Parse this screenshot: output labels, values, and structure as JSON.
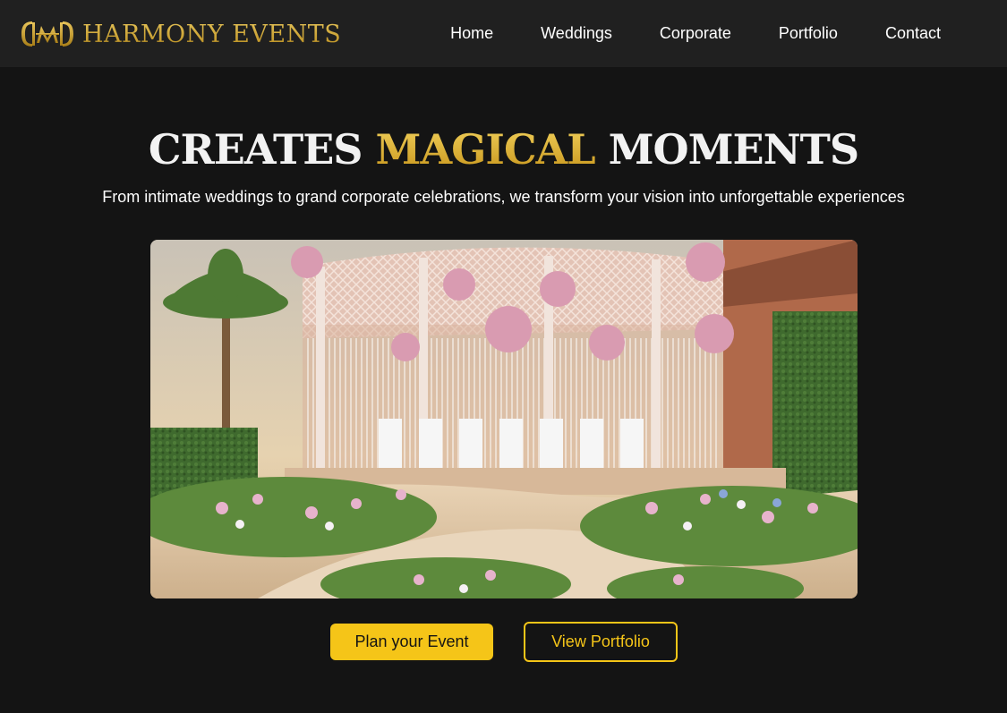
{
  "brand": {
    "name": "HARMONY EVENTS",
    "logo_icon": "monogram-logo-icon",
    "accent_color": "#c9a22c"
  },
  "nav": {
    "items": [
      {
        "label": "Home"
      },
      {
        "label": "Weddings"
      },
      {
        "label": "Corporate"
      },
      {
        "label": "Portfolio"
      },
      {
        "label": "Contact"
      }
    ]
  },
  "hero": {
    "title_part1": "CREATES",
    "title_accent": "MAGICAL",
    "title_part2": "MOMENTS",
    "subtitle": "From intimate weddings to grand corporate celebrations, we transform your vision into unforgettable experiences",
    "image_alt": "Outdoor wedding ceremony setup with floral arch and white chairs"
  },
  "cta": {
    "primary_label": "Plan your Event",
    "secondary_label": "View Portfolio",
    "accent_color": "#f5c518"
  },
  "colors": {
    "background": "#141414",
    "navbar": "#202020"
  }
}
